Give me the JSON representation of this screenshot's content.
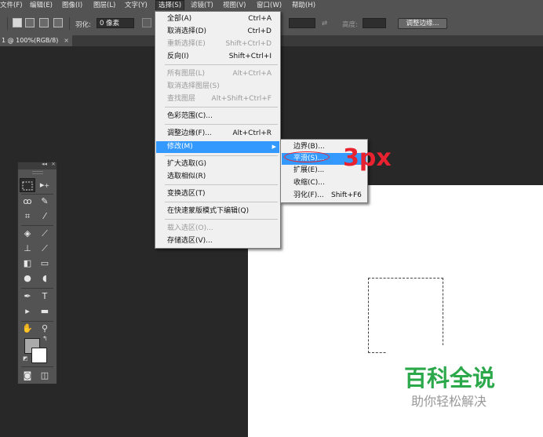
{
  "menubar": {
    "items": [
      "文件(F)",
      "编辑(E)",
      "图像(I)",
      "图层(L)",
      "文字(Y)",
      "选择(S)",
      "滤镜(T)",
      "视图(V)",
      "窗口(W)",
      "帮助(H)"
    ]
  },
  "options": {
    "feather_label": "羽化:",
    "feather_value": "0 像素",
    "height_label": "高度:",
    "refine_edge_button": "调整边缘..."
  },
  "document": {
    "tab_title": "1 @ 100%(RGB/8)",
    "close_glyph": "×"
  },
  "tools_panel": {
    "collapse_glyph": "◂◂",
    "close_glyph": "×",
    "tools": [
      "rect-marquee",
      "move",
      "lasso",
      "quick-select",
      "crop",
      "eyedropper",
      "healing-brush",
      "brush",
      "clone-stamp",
      "history-brush",
      "eraser",
      "gradient",
      "blur",
      "dodge",
      "pen",
      "type",
      "path-select",
      "shape",
      "hand",
      "zoom"
    ]
  },
  "select_menu": {
    "items": [
      {
        "label": "全部(A)",
        "shortcut": "Ctrl+A",
        "disabled": false
      },
      {
        "label": "取消选择(D)",
        "shortcut": "Ctrl+D",
        "disabled": false
      },
      {
        "label": "重新选择(E)",
        "shortcut": "Shift+Ctrl+D",
        "disabled": true
      },
      {
        "label": "反向(I)",
        "shortcut": "Shift+Ctrl+I",
        "disabled": false
      },
      {
        "label": "所有图层(L)",
        "shortcut": "Alt+Ctrl+A",
        "disabled": true
      },
      {
        "label": "取消选择图层(S)",
        "shortcut": "",
        "disabled": true
      },
      {
        "label": "查找图层",
        "shortcut": "Alt+Shift+Ctrl+F",
        "disabled": true
      },
      {
        "label": "色彩范围(C)...",
        "shortcut": "",
        "disabled": false
      },
      {
        "label": "调整边缘(F)...",
        "shortcut": "Alt+Ctrl+R",
        "disabled": false
      },
      {
        "label": "修改(M)",
        "shortcut": "",
        "disabled": false,
        "highlighted": true,
        "submenu_arrow": "▶"
      },
      {
        "label": "扩大选取(G)",
        "shortcut": "",
        "disabled": false
      },
      {
        "label": "选取相似(R)",
        "shortcut": "",
        "disabled": false
      },
      {
        "label": "变换选区(T)",
        "shortcut": "",
        "disabled": false
      },
      {
        "label": "在快速蒙版模式下编辑(Q)",
        "shortcut": "",
        "disabled": false
      },
      {
        "label": "载入选区(O)...",
        "shortcut": "",
        "disabled": true
      },
      {
        "label": "存储选区(V)...",
        "shortcut": "",
        "disabled": false
      }
    ]
  },
  "modify_submenu": {
    "items": [
      {
        "label": "边界(B)...",
        "shortcut": ""
      },
      {
        "label": "平滑(S)...",
        "shortcut": "",
        "highlighted": true
      },
      {
        "label": "扩展(E)...",
        "shortcut": ""
      },
      {
        "label": "收缩(C)...",
        "shortcut": ""
      },
      {
        "label": "羽化(F)...",
        "shortcut": "Shift+F6"
      }
    ]
  },
  "annotation": {
    "text": "3px",
    "color": "#e8222f"
  },
  "watermark": {
    "title": "百科全说",
    "subtitle": "助你轻松解决",
    "title_color": "#2aa84a"
  },
  "colors": {
    "menu_highlight": "#3399ff",
    "workspace": "#282828",
    "panel": "#535353"
  }
}
